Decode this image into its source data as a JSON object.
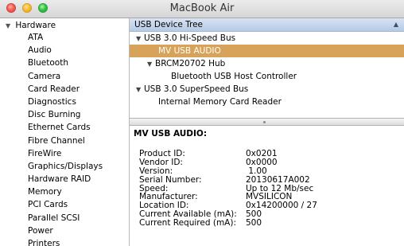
{
  "window": {
    "title": "MacBook Air"
  },
  "sidebar": {
    "header": "Hardware",
    "items": [
      "ATA",
      "Audio",
      "Bluetooth",
      "Camera",
      "Card Reader",
      "Diagnostics",
      "Disc Burning",
      "Ethernet Cards",
      "Fibre Channel",
      "FireWire",
      "Graphics/Displays",
      "Hardware RAID",
      "Memory",
      "PCI Cards",
      "Parallel SCSI",
      "Power",
      "Printers"
    ]
  },
  "tree": {
    "header": "USB Device Tree",
    "rows": [
      {
        "label": "USB 3.0 Hi-Speed Bus",
        "expander": "▼"
      },
      {
        "label": "MV USB AUDIO",
        "expander": ""
      },
      {
        "label": "BRCM20702 Hub",
        "expander": "▼"
      },
      {
        "label": "Bluetooth USB Host Controller",
        "expander": ""
      },
      {
        "label": "USB 3.0 SuperSpeed Bus",
        "expander": "▼"
      },
      {
        "label": "Internal Memory Card Reader",
        "expander": ""
      }
    ]
  },
  "detail": {
    "title": "MV USB AUDIO:",
    "properties": [
      {
        "key": "Product ID:",
        "value": "0x0201"
      },
      {
        "key": "Vendor ID:",
        "value": "0x0000"
      },
      {
        "key": "Version:",
        "value": " 1.00"
      },
      {
        "key": "Serial Number:",
        "value": "20130617A002"
      },
      {
        "key": "Speed:",
        "value": "Up to 12 Mb/sec"
      },
      {
        "key": "Manufacturer:",
        "value": "MVSILICON"
      },
      {
        "key": "Location ID:",
        "value": "0x14200000 / 27"
      },
      {
        "key": "Current Available (mA):",
        "value": "500"
      },
      {
        "key": "Current Required (mA):",
        "value": "500"
      }
    ]
  },
  "colors": {
    "selection": "#d7a35a",
    "header_blue": "#c6d6ee"
  }
}
